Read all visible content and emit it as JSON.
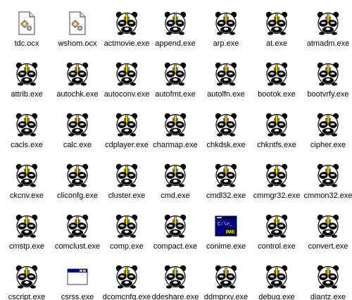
{
  "window": {
    "view": "icons"
  },
  "colors": {
    "background": "#ffffff",
    "label_text": "#000000",
    "panda_black": "#000000",
    "panda_white": "#ffffff",
    "panda_eye_gray": "#c8c8c8",
    "panda_nose_yellow": "#f0d020",
    "console_blue": "#000080",
    "console_yellow": "#ffff00"
  },
  "files": [
    [
      {
        "name": "tdc.ocx",
        "icon": "ocx-file-icon"
      },
      {
        "name": "wshom.ocx",
        "icon": "ocx-file-icon"
      },
      {
        "name": "actmovie.exe",
        "icon": "panda-exe-icon"
      },
      {
        "name": "append.exe",
        "icon": "panda-exe-icon"
      },
      {
        "name": "arp.exe",
        "icon": "panda-exe-icon"
      },
      {
        "name": "at.exe",
        "icon": "panda-exe-icon"
      },
      {
        "name": "atmadm.exe",
        "icon": "panda-exe-icon"
      }
    ],
    [
      {
        "name": "attrib.exe",
        "icon": "panda-exe-icon"
      },
      {
        "name": "autochk.exe",
        "icon": "panda-exe-icon"
      },
      {
        "name": "autoconv.exe",
        "icon": "panda-exe-icon"
      },
      {
        "name": "autofmt.exe",
        "icon": "panda-exe-icon"
      },
      {
        "name": "autolfn.exe",
        "icon": "panda-exe-icon"
      },
      {
        "name": "bootok.exe",
        "icon": "panda-exe-icon"
      },
      {
        "name": "bootvrfy.exe",
        "icon": "panda-exe-icon"
      }
    ],
    [
      {
        "name": "cacls.exe",
        "icon": "panda-exe-icon"
      },
      {
        "name": "calc.exe",
        "icon": "panda-exe-icon"
      },
      {
        "name": "cdplayer.exe",
        "icon": "panda-exe-icon"
      },
      {
        "name": "charmap.exe",
        "icon": "panda-exe-icon"
      },
      {
        "name": "chkdsk.exe",
        "icon": "panda-exe-icon"
      },
      {
        "name": "chkntfs.exe",
        "icon": "panda-exe-icon"
      },
      {
        "name": "cipher.exe",
        "icon": "panda-exe-icon"
      }
    ],
    [
      {
        "name": "ckcnv.exe",
        "icon": "panda-exe-icon"
      },
      {
        "name": "cliconfg.exe",
        "icon": "panda-exe-icon"
      },
      {
        "name": "cluster.exe",
        "icon": "panda-exe-icon"
      },
      {
        "name": "cmd.exe",
        "icon": "panda-exe-icon"
      },
      {
        "name": "cmdl32.exe",
        "icon": "panda-exe-icon"
      },
      {
        "name": "cmmgr32.exe",
        "icon": "panda-exe-icon"
      },
      {
        "name": "cmmon32.exe",
        "icon": "panda-exe-icon"
      }
    ],
    [
      {
        "name": "cmstp.exe",
        "icon": "panda-exe-icon"
      },
      {
        "name": "comclust.exe",
        "icon": "panda-exe-icon"
      },
      {
        "name": "comp.exe",
        "icon": "panda-exe-icon"
      },
      {
        "name": "compact.exe",
        "icon": "panda-exe-icon"
      },
      {
        "name": "conime.exe",
        "icon": "console-ime-icon",
        "icon_text": "C:\\>_",
        "icon_badge": "IME"
      },
      {
        "name": "control.exe",
        "icon": "panda-exe-icon"
      },
      {
        "name": "convert.exe",
        "icon": "panda-exe-icon"
      }
    ],
    [
      {
        "name": "cscript.exe",
        "icon": "panda-exe-icon"
      },
      {
        "name": "csrss.exe",
        "icon": "window-app-icon"
      },
      {
        "name": "dcomcnfg.exe",
        "icon": "panda-exe-icon"
      },
      {
        "name": "ddeshare.exe",
        "icon": "panda-exe-icon"
      },
      {
        "name": "ddmprxy.exe",
        "icon": "panda-exe-icon"
      },
      {
        "name": "debug.exe",
        "icon": "panda-exe-icon"
      },
      {
        "name": "diantz.exe",
        "icon": "panda-exe-icon"
      }
    ]
  ]
}
